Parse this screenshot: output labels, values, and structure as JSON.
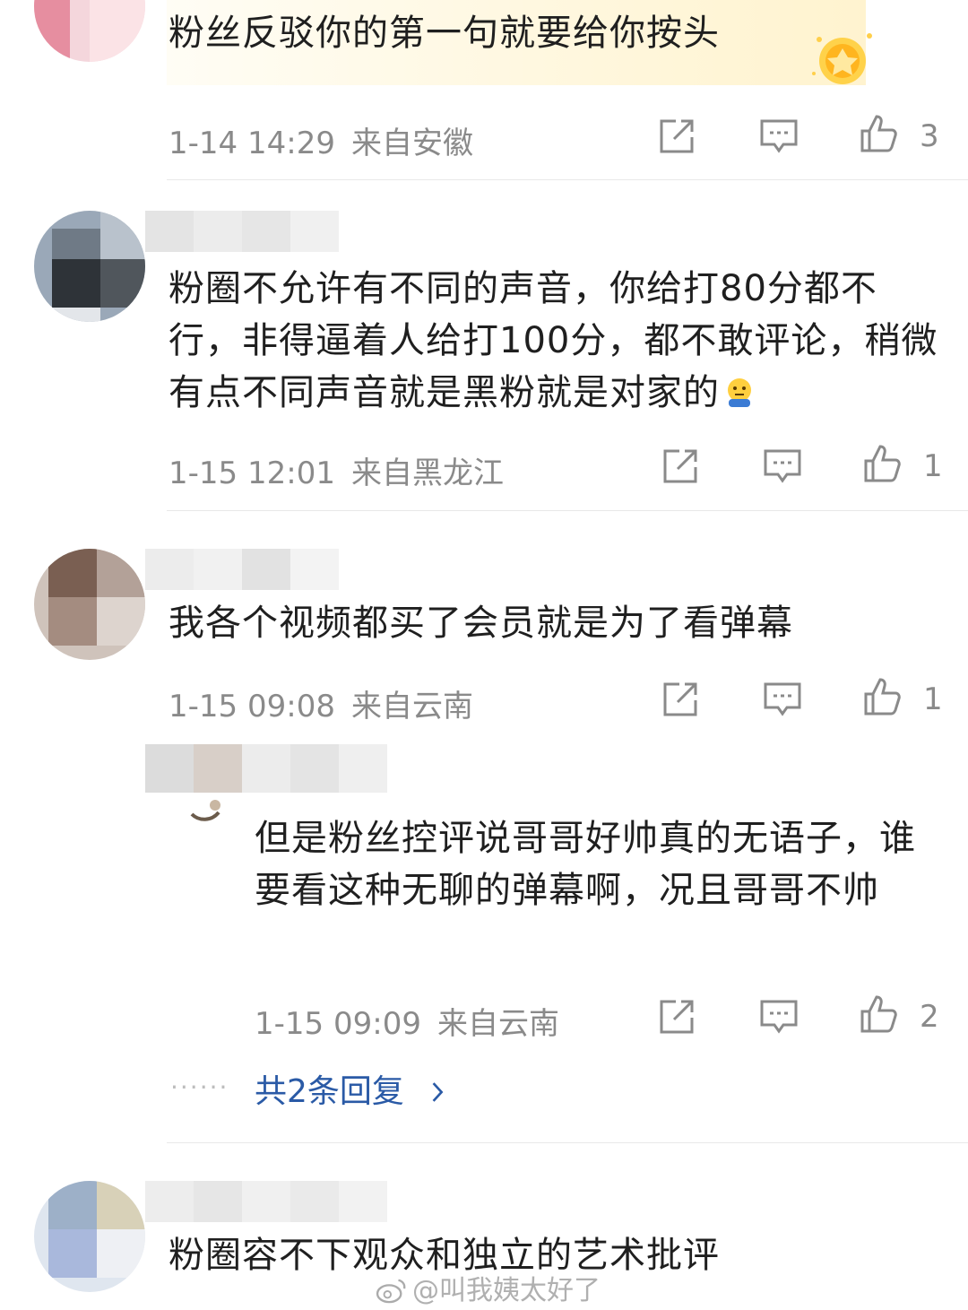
{
  "comments": [
    {
      "text": "粉丝反驳你的第一句就要给你按头",
      "time": "1-14 14:29",
      "location": "来自安徽",
      "likes": "3"
    },
    {
      "text": "粉圈不允许有不同的声音，你给打80分都不行，非得逼着人给打100分，都不敢评论，稍微有点不同声音就是黑粉就是对家的",
      "time": "1-15 12:01",
      "location": "来自黑龙江",
      "likes": "1"
    },
    {
      "text": "我各个视频都买了会员就是为了看弹幕",
      "time": "1-15 09:08",
      "location": "来自云南",
      "likes": "1",
      "reply": {
        "text": "但是粉丝控评说哥哥好帅真的无语子，谁要看这种无聊的弹幕啊，况且哥哥不帅",
        "time": "1-15 09:09",
        "location": "来自云南",
        "likes": "2"
      },
      "dots": "······",
      "reply_link": "共2条回复",
      "reply_link_icon": "chevron-right-icon"
    },
    {
      "text": "粉圈容不下观众和独立的艺术批评"
    }
  ],
  "watermark": "@叫我姨太好了",
  "colors": {
    "link": "#2a5aa6",
    "meta": "#8a8a8a",
    "divider": "#e8e8e8"
  }
}
